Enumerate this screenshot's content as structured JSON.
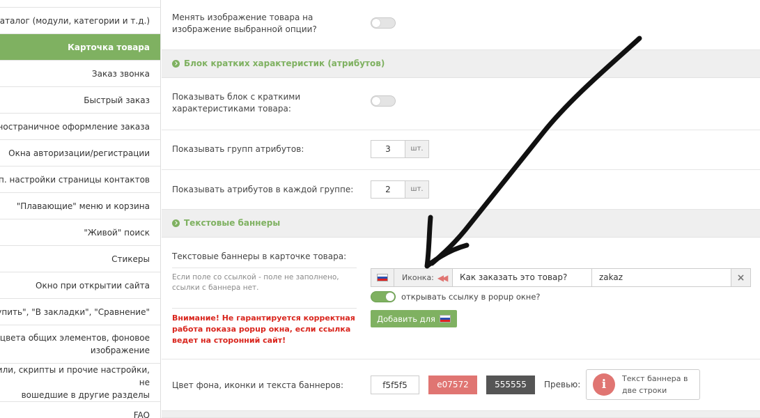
{
  "sidebar": {
    "items": [
      {
        "label": "Каталог (модули, категории и т.д.)"
      },
      {
        "label": "Карточка товара"
      },
      {
        "label": "Заказ звонка"
      },
      {
        "label": "Быстрый заказ"
      },
      {
        "label": "Одностраничное оформление заказа"
      },
      {
        "label": "Окна авторизации/регистрации"
      },
      {
        "label": "Доп. настройки страницы контактов"
      },
      {
        "label": "\"Плавающие\" меню и корзина"
      },
      {
        "label": "\"Живой\" поиск"
      },
      {
        "label": "Стикеры"
      },
      {
        "label": "Окно при открытии сайта"
      },
      {
        "label": "и \"Купить\", \"В закладки\", \"Сравнение\""
      },
      {
        "label_line1": "ка цвета общих элементов, фоновое",
        "label_line2": "изображение"
      },
      {
        "label_line1": "или, скрипты и прочие настройки, не",
        "label_line2": "вошедшие в другие разделы"
      },
      {
        "label": "FAQ"
      }
    ]
  },
  "main": {
    "option_image": {
      "label": "Менять изображение товара на изображение выбранной опции?",
      "enabled": false
    },
    "section_attrs": {
      "title": "Блок кратких характеристик (атрибутов)"
    },
    "show_attrs_block": {
      "label": "Показывать блок с краткими характеристиками товара:",
      "enabled": false
    },
    "attr_groups": {
      "label": "Показывать групп атрибутов:",
      "value": "3",
      "unit": "шт."
    },
    "attrs_per_group": {
      "label": "Показывать атрибутов в каждой группе:",
      "value": "2",
      "unit": "шт."
    },
    "section_banners": {
      "title": "Текстовые баннеры"
    },
    "banners": {
      "label": "Текстовые баннеры в карточке товара:",
      "hint": "Если поле со ссылкой - поле не заполнено, ссылки с баннера нет.",
      "warning": "Внимание! Не гарантируется корректная работа показа popup окна, если ссылка ведет на сторонний сайт!",
      "row": {
        "icon_label": "Иконка:",
        "text": "Как заказать это товар?",
        "link": "zakaz",
        "delete": "×"
      },
      "popup_toggle": {
        "label": "открывать ссылку в popup окне?",
        "enabled": true
      },
      "add_button": "Добавить для"
    },
    "banner_colors": {
      "label": "Цвет фона, иконки и текста баннеров:",
      "bg": "f5f5f5",
      "icon": "e07572",
      "text": "555555",
      "preview_label": "Превью:",
      "preview_text": "Текст баннера в две строки",
      "preview_icon_glyph": "i"
    }
  },
  "colors": {
    "accent": "#7fb161",
    "bg": "#f5f5f5",
    "icon": "#e07572",
    "text": "#555555",
    "warning": "#d9251d"
  }
}
